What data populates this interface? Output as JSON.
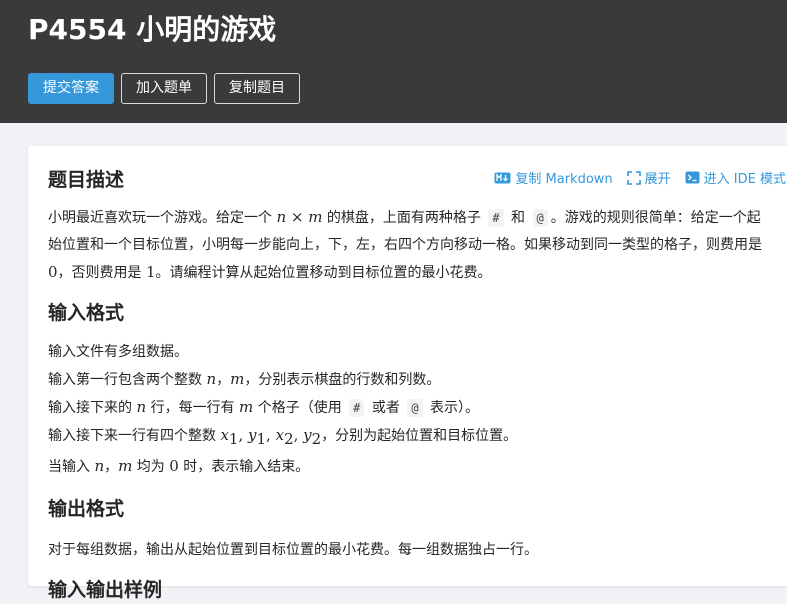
{
  "header": {
    "title": "P4554 小明的游戏",
    "buttons": {
      "submit": "提交答案",
      "add_to_list": "加入题单",
      "copy_problem": "复制题目"
    }
  },
  "card": {
    "description_title": "题目描述",
    "actions": {
      "copy_markdown": "复制 Markdown",
      "expand": "展开",
      "ide_mode": "进入 IDE 模式"
    },
    "description": {
      "t1": "小明最近喜欢玩一个游戏。给定一个 ",
      "m_n": "n",
      "m_times": " × ",
      "m_m": "m",
      "t2": " 的棋盘，上面有两种格子 ",
      "code_hash": "#",
      "t3": " 和 ",
      "code_at": "@",
      "t4": "。游戏的规则很简单：给定一个起始位置和一个目标位置，小明每一步能向上，下，左，右四个方向移动一格。如果移动到同一类型的格子，则费用是 ",
      "zero": "0",
      "t5": "，否则费用是 ",
      "one": "1",
      "t6": "。请编程计算从起始位置移动到目标位置的最小花费。"
    },
    "input_title": "输入格式",
    "input": {
      "l1": "输入文件有多组数据。",
      "l2a": "输入第一行包含两个整数 ",
      "l2_n": "n",
      "l2_sep": "，",
      "l2_m": "m",
      "l2b": "，分别表示棋盘的行数和列数。",
      "l3a": "输入接下来的 ",
      "l3_n": "n",
      "l3b": " 行，每一行有 ",
      "l3_m": "m",
      "l3c": " 个格子（使用 ",
      "l3_hash": "#",
      "l3d": " 或者 ",
      "l3_at": "@",
      "l3e": " 表示）。",
      "l4a": "输入接下来一行有四个整数 ",
      "l4_x": "x",
      "l4_1": "1",
      "l4_y": "y",
      "l4_x2": "x",
      "l4_2": "2",
      "l4_y2": "y",
      "l4_comma": ", ",
      "l4b": "，分别为起始位置和目标位置。",
      "l5a": "当输入 ",
      "l5_n": "n",
      "l5_sep": "，",
      "l5_m": "m",
      "l5b": " 均为 ",
      "l5_zero": "0",
      "l5c": " 时，表示输入结束。"
    },
    "output_title": "输出格式",
    "output": {
      "l1": "对于每组数据，输出从起始位置到目标位置的最小花费。每一组数据独占一行。"
    },
    "next_title": "输入输出样例"
  },
  "colors": {
    "header_bg": "#3a3a3a",
    "primary": "#3498db",
    "page_bg": "#f0f2f5"
  },
  "icons": [
    "markdown-icon",
    "expand-icon",
    "terminal-icon"
  ]
}
